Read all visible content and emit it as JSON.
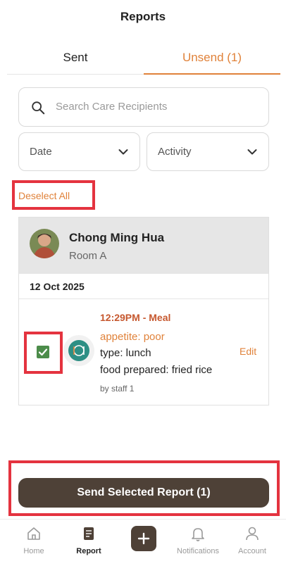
{
  "header": {
    "title": "Reports"
  },
  "tabs": [
    {
      "label": "Sent",
      "active": false
    },
    {
      "label": "Unsend (1)",
      "active": true
    }
  ],
  "search": {
    "placeholder": "Search Care Recipients",
    "icon": "search-icon"
  },
  "filters": {
    "date_label": "Date",
    "activity_label": "Activity"
  },
  "actions": {
    "deselect_all": "Deselect All",
    "send_selected": "Send Selected Report (1)"
  },
  "report_group": {
    "recipient_name": "Chong Ming Hua",
    "room": "Room A",
    "date": "12 Oct 2025",
    "entry": {
      "selected": true,
      "time_activity": "12:29PM - Meal",
      "appetite": "appetite: poor",
      "type": "type: lunch",
      "food": "food prepared: fried rice",
      "staff": "by staff 1",
      "edit_label": "Edit",
      "icon": "meal-icon"
    }
  },
  "bottom_nav": [
    {
      "label": "Home",
      "icon": "home-icon",
      "active": false
    },
    {
      "label": "Report",
      "icon": "report-icon",
      "active": true
    },
    {
      "label": "",
      "icon": "plus-icon",
      "active": false
    },
    {
      "label": "Notifications",
      "icon": "bell-icon",
      "active": false
    },
    {
      "label": "Account",
      "icon": "account-icon",
      "active": false
    }
  ],
  "colors": {
    "accent": "#e0823a",
    "button_brown": "#4e4137",
    "highlight_red": "#e4333f",
    "checkbox_green": "#4c8c4a",
    "meal_teal": "#2e8f85"
  }
}
